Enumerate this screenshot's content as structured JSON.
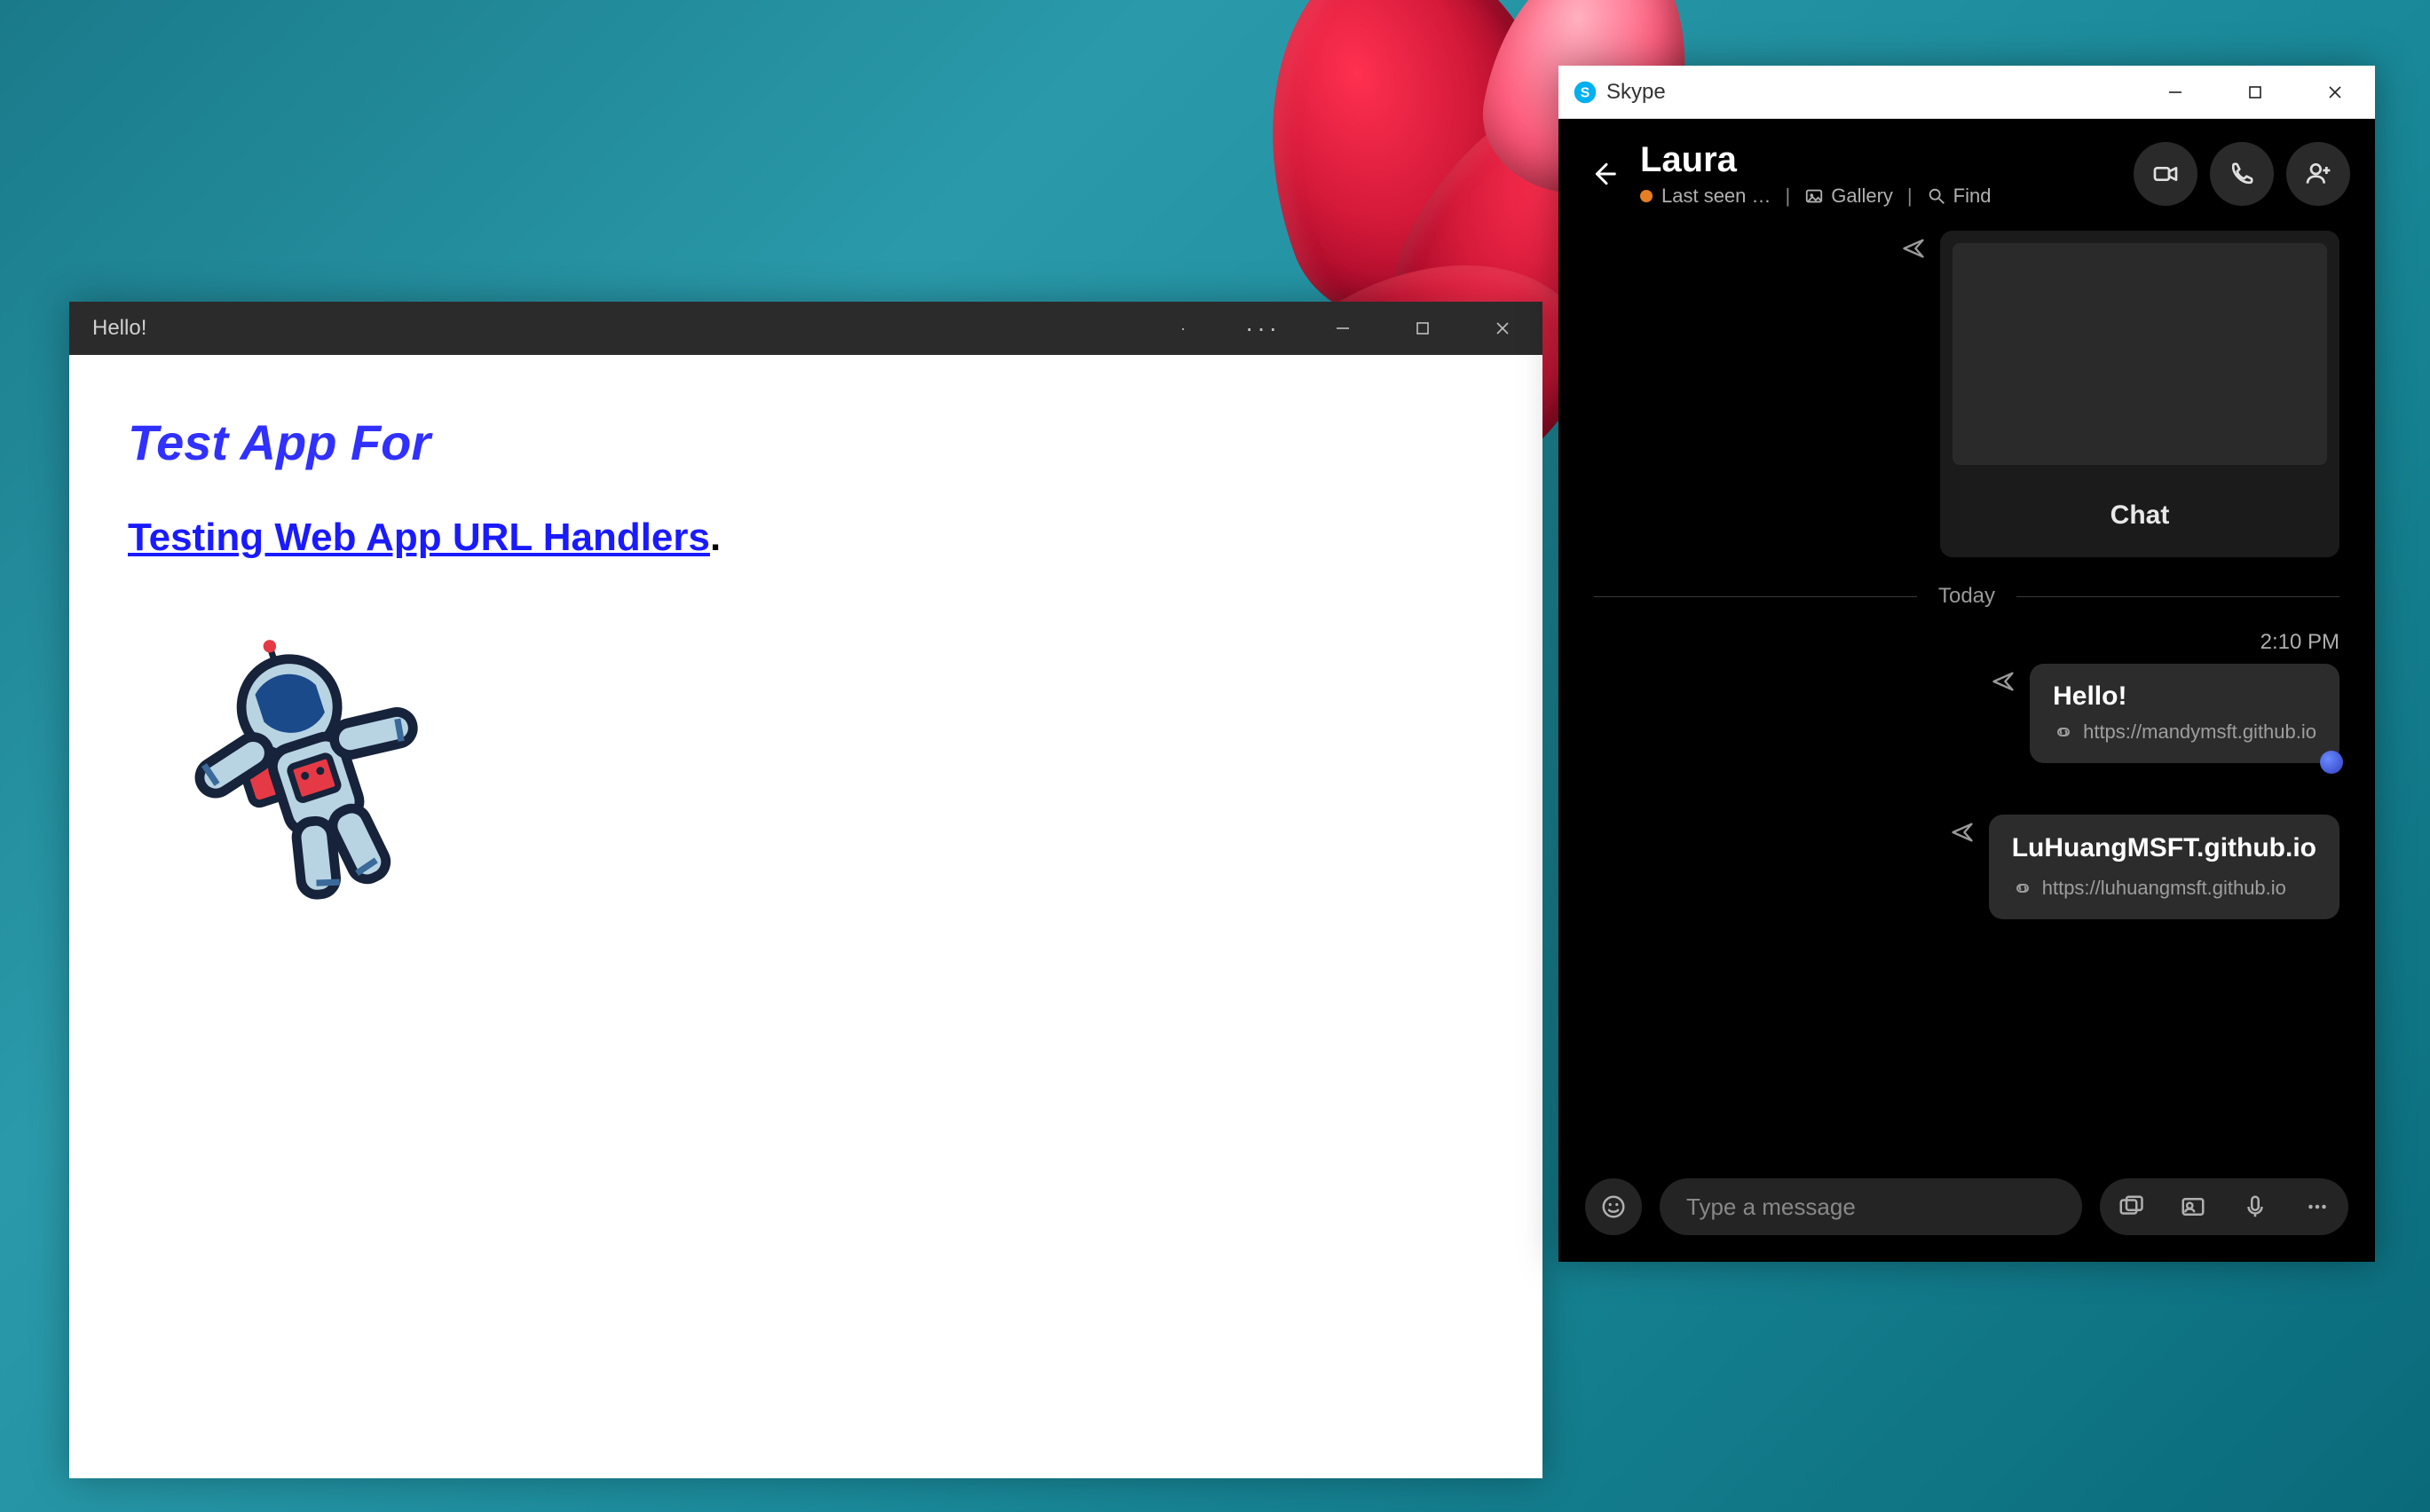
{
  "app_window": {
    "title": "Hello!",
    "heading": "Test App For",
    "link_text": "Testing Web App URL Handlers",
    "link_suffix": "."
  },
  "skype": {
    "titlebar": {
      "app_name": "Skype"
    },
    "contact": {
      "name": "Laura",
      "status_text": "Last seen …",
      "gallery_label": "Gallery",
      "find_label": "Find"
    },
    "card": {
      "button_label": "Chat"
    },
    "divider_label": "Today",
    "timestamp": "2:10 PM",
    "messages": [
      {
        "title": "Hello!",
        "url": "https://mandymsft.github.io"
      },
      {
        "title": "LuHuangMSFT.github.io",
        "url": "https://luhuangmsft.github.io"
      }
    ],
    "compose": {
      "placeholder": "Type a message"
    }
  }
}
